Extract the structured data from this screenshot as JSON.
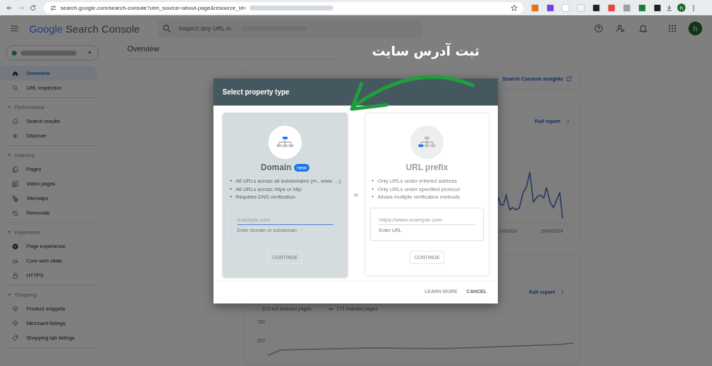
{
  "browser": {
    "url": "search.google.com/search-console?utm_source=about-page&resource_id=",
    "avatar": "h"
  },
  "header": {
    "brand_google": "Google",
    "brand_product": "Search Console",
    "search_placeholder": "Inspect any URL in",
    "avatar": "h"
  },
  "sidebar": {
    "items": [
      {
        "label": "Overview",
        "selected": true
      },
      {
        "label": "URL inspection",
        "selected": false
      }
    ],
    "sections": [
      {
        "title": "Performance",
        "items": [
          {
            "label": "Search results",
            "selected": false
          },
          {
            "label": "Discover",
            "selected": false
          }
        ]
      },
      {
        "title": "Indexing",
        "items": [
          {
            "label": "Pages",
            "selected": false
          },
          {
            "label": "Video pages",
            "selected": false
          },
          {
            "label": "Sitemaps",
            "selected": false
          },
          {
            "label": "Removals",
            "selected": false
          }
        ]
      },
      {
        "title": "Experience",
        "items": [
          {
            "label": "Page experience",
            "selected": false
          },
          {
            "label": "Core web vitals",
            "selected": false
          },
          {
            "label": "HTTPS",
            "selected": false
          }
        ]
      },
      {
        "title": "Shopping",
        "items": [
          {
            "label": "Product snippets",
            "selected": false
          },
          {
            "label": "Merchant listings",
            "selected": false
          },
          {
            "label": "Shopping tab listings",
            "selected": false
          }
        ]
      }
    ]
  },
  "main": {
    "title": "Overview",
    "insights_link": "Search Console Insights",
    "performance": {
      "link": "Full report",
      "dates": [
        "/04/2024",
        "29/04/2024"
      ]
    },
    "indexing": {
      "link": "Full report",
      "legend": [
        {
          "label": "613 not indexed pages",
          "color": "#707070"
        },
        {
          "label": "171 indexed pages",
          "color": "#1d5c30"
        }
      ],
      "y_labels": [
        "750",
        "500"
      ]
    }
  },
  "dialog": {
    "title": "Select property type",
    "separator": "or",
    "options": [
      {
        "name": "Domain",
        "badge": "new",
        "selected": true,
        "bullets": [
          "All URLs across all subdomains (m., www. ...)",
          "All URLs across https or http",
          "Requires DNS verification"
        ],
        "placeholder": "example.com",
        "helper": "Enter domain or subdomain",
        "button": {
          "label": "CONTINUE",
          "disabled": true
        }
      },
      {
        "name": "URL prefix",
        "selected": false,
        "bullets": [
          "Only URLs under entered address",
          "Only URLs under specified protocol",
          "Allows multiple verification methods"
        ],
        "placeholder": "https://www.example.com",
        "helper": "Enter URL",
        "button": {
          "label": "CONTINUE",
          "disabled": true
        }
      }
    ],
    "actions": [
      {
        "label": "LEARN MORE",
        "kind": "secondary"
      },
      {
        "label": "CANCEL",
        "kind": "primary"
      }
    ]
  },
  "annotation": {
    "text": "ثبت آدرس سایت"
  }
}
